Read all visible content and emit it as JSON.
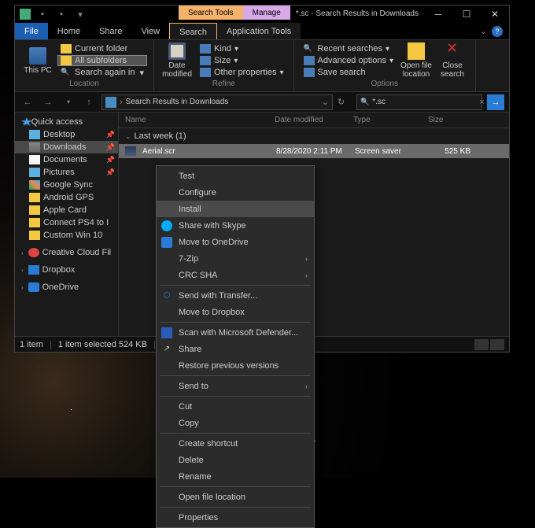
{
  "window": {
    "title": "*.sc - Search Results in Downloads",
    "context_tabs": {
      "search": "Search Tools",
      "manage": "Manage"
    }
  },
  "ribbon_tabs": {
    "file": "File",
    "home": "Home",
    "share": "Share",
    "view": "View",
    "search": "Search",
    "app_tools": "Application Tools"
  },
  "ribbon": {
    "location": {
      "this_pc": "This PC",
      "current_folder": "Current folder",
      "all_subfolders": "All subfolders",
      "search_again": "Search again in",
      "label": "Location"
    },
    "refine": {
      "date_modified": "Date modified",
      "kind": "Kind",
      "size": "Size",
      "other": "Other properties",
      "label": "Refine"
    },
    "options": {
      "recent": "Recent searches",
      "advanced": "Advanced options",
      "save": "Save search",
      "open": "Open file location",
      "close": "Close search",
      "label": "Options"
    }
  },
  "address": {
    "crumb": "Search Results in Downloads",
    "search_value": "*.sc"
  },
  "columns": {
    "name": "Name",
    "date": "Date modified",
    "type": "Type",
    "size": "Size"
  },
  "nav": {
    "quick_access": "Quick access",
    "items": [
      {
        "label": "Desktop",
        "icon": "desktop",
        "pin": true
      },
      {
        "label": "Downloads",
        "icon": "down",
        "pin": true,
        "selected": true
      },
      {
        "label": "Documents",
        "icon": "doc",
        "pin": true
      },
      {
        "label": "Pictures",
        "icon": "pic",
        "pin": true
      },
      {
        "label": "Google Sync",
        "icon": "gdrive"
      },
      {
        "label": "Android GPS",
        "icon": "folder"
      },
      {
        "label": "Apple Card",
        "icon": "folder"
      },
      {
        "label": "Connect PS4 to I",
        "icon": "folder"
      },
      {
        "label": "Custom Win 10",
        "icon": "folder"
      }
    ],
    "creative_cloud": "Creative Cloud Fil",
    "dropbox": "Dropbox",
    "onedrive": "OneDrive"
  },
  "group": "Last week (1)",
  "file": {
    "name": "Aerial.scr",
    "date": "8/28/2020 2:11 PM",
    "type": "Screen saver",
    "size": "525 KB"
  },
  "status": {
    "count": "1 item",
    "selected": "1 item selected  524 KB"
  },
  "context_menu": [
    {
      "label": "Test"
    },
    {
      "label": "Configure"
    },
    {
      "label": "Install",
      "hover": true
    },
    {
      "label": "Share with Skype",
      "icon": "skype"
    },
    {
      "label": "Move to OneDrive",
      "icon": "od"
    },
    {
      "label": "7-Zip",
      "sub": true
    },
    {
      "label": "CRC SHA",
      "sub": true
    },
    {
      "sep": true
    },
    {
      "label": "Send with Transfer...",
      "icon": "dbx"
    },
    {
      "label": "Move to Dropbox"
    },
    {
      "sep": true
    },
    {
      "label": "Scan with Microsoft Defender...",
      "icon": "def"
    },
    {
      "label": "Share",
      "icon": "share"
    },
    {
      "label": "Restore previous versions"
    },
    {
      "sep": true
    },
    {
      "label": "Send to",
      "sub": true
    },
    {
      "sep": true
    },
    {
      "label": "Cut"
    },
    {
      "label": "Copy"
    },
    {
      "sep": true
    },
    {
      "label": "Create shortcut"
    },
    {
      "label": "Delete"
    },
    {
      "label": "Rename"
    },
    {
      "sep": true
    },
    {
      "label": "Open file location"
    },
    {
      "sep": true
    },
    {
      "label": "Properties"
    }
  ]
}
